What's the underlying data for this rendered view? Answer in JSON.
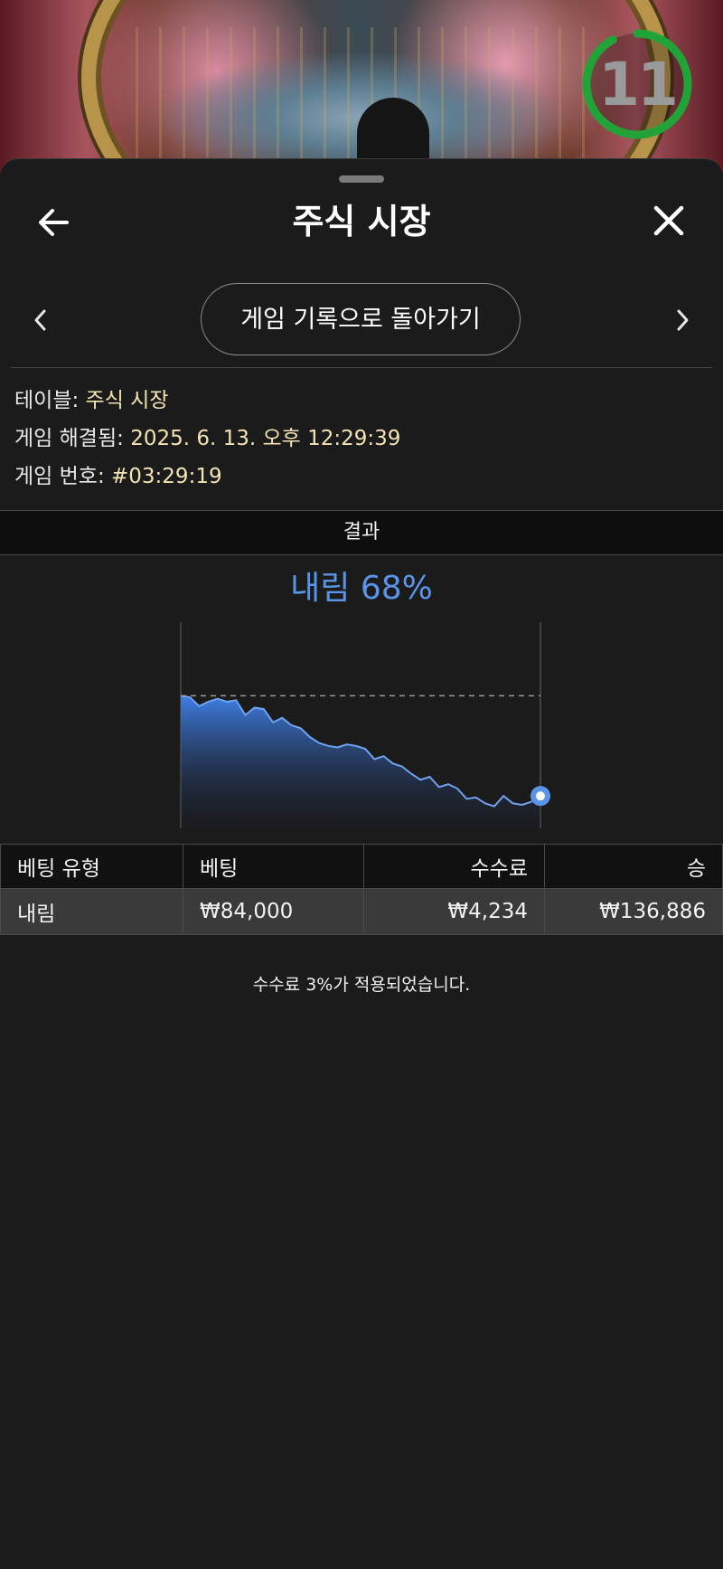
{
  "timer": {
    "remaining": "11",
    "progress": 0.92,
    "color": "#22a338"
  },
  "header": {
    "title": "주식 시장",
    "back_icon": "arrow-left-icon",
    "close_icon": "close-icon"
  },
  "history_nav": {
    "back_to_history_label": "게임 기록으로 돌아가기",
    "prev_icon": "chevron-left-icon",
    "next_icon": "chevron-right-icon"
  },
  "info": {
    "table_label": "테이블:",
    "table_value": "주식 시장",
    "resolved_label": "게임 해결됨:",
    "resolved_value": "2025. 6. 13. 오후 12:29:39",
    "game_number_label": "게임 번호:",
    "game_number_value": "#03:29:19"
  },
  "result": {
    "section_label": "결과",
    "outcome": "내림 68%",
    "accent_color": "#5a94e8"
  },
  "chart_data": {
    "type": "area",
    "title": "",
    "xlabel": "",
    "ylabel": "",
    "baseline": 1.0,
    "ylim": [
      0.1,
      1.5
    ],
    "x": [
      0,
      1,
      2,
      3,
      4,
      5,
      6,
      7,
      8,
      9,
      10,
      11,
      12,
      13,
      14,
      15,
      16,
      17,
      18,
      19,
      20,
      21,
      22,
      23,
      24,
      25,
      26,
      27,
      28,
      29,
      30,
      31,
      32,
      33,
      34,
      35,
      36,
      37,
      38,
      39
    ],
    "series": [
      {
        "values": [
          1.0,
          0.99,
          0.93,
          0.96,
          0.98,
          0.96,
          0.97,
          0.87,
          0.92,
          0.91,
          0.82,
          0.85,
          0.8,
          0.78,
          0.72,
          0.68,
          0.66,
          0.65,
          0.67,
          0.66,
          0.64,
          0.57,
          0.59,
          0.54,
          0.52,
          0.47,
          0.43,
          0.45,
          0.38,
          0.4,
          0.37,
          0.3,
          0.31,
          0.27,
          0.25,
          0.32,
          0.27,
          0.26,
          0.28,
          0.32
        ]
      }
    ],
    "grid": false,
    "legend": "none"
  },
  "bets_table": {
    "headers": [
      "베팅 유형",
      "베팅",
      "수수료",
      "승"
    ],
    "rows": [
      [
        "내림",
        "₩84,000",
        "₩4,234",
        "₩136,886"
      ]
    ]
  },
  "fee_note": "수수료 3%가 적용되었습니다."
}
